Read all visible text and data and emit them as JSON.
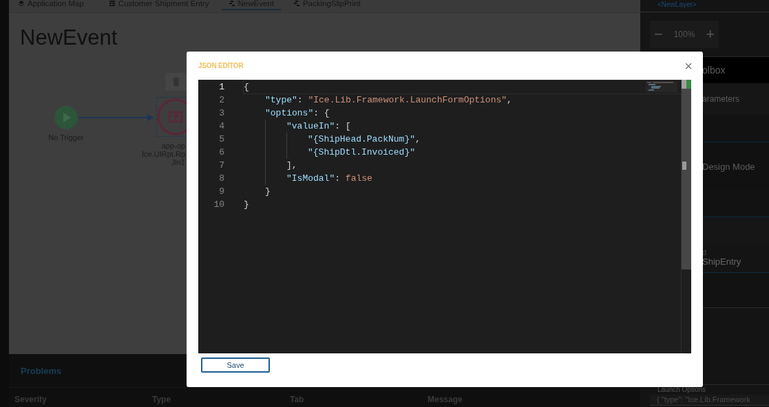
{
  "tabs": [
    {
      "label": "Application Map",
      "kind": "map",
      "selected": false
    },
    {
      "label": "Customer Shipment Entry",
      "kind": "form",
      "selected": false
    },
    {
      "label": "NewEvent",
      "kind": "event",
      "selected": true
    },
    {
      "label": "PackingSlipPrint",
      "kind": "event",
      "selected": false
    }
  ],
  "canvas": {
    "title": "NewEvent",
    "nodes": [
      {
        "kind": "trigger",
        "label_lines": [
          "No Trigger"
        ]
      },
      {
        "kind": "action",
        "label_lines": [
          "app-op",
          "Ice.UIRpt.Rp",
          "Jln1"
        ],
        "selected": true
      }
    ]
  },
  "problems": {
    "title": "Problems",
    "columns": [
      "Severity",
      "Type",
      "Tab",
      "Message"
    ]
  },
  "right_panel": {
    "layer": "<NewLayer>",
    "zoom": {
      "minus": "−",
      "value": "100%",
      "plus": "+"
    },
    "sections": [
      "olbox",
      "arameters",
      "Design Mode"
    ],
    "field_label": "d",
    "field_value": "ShipEntry",
    "options_label": "Launch Options",
    "options_value": "{ \"type\": \"Ice.Lib.Framework"
  },
  "dialog": {
    "title": "JSON EDITOR",
    "close": "×",
    "save": "Save",
    "code": [
      {
        "number": "1",
        "active": true,
        "tokens": [
          {
            "kind": "punct",
            "text": "{"
          }
        ],
        "children": [
          {
            "number": "2",
            "active": false,
            "tokens": [
              {
                "kind": "key",
                "text": "\"type\""
              },
              {
                "kind": "punct",
                "text": ": "
              },
              {
                "kind": "string",
                "text": "\"Ice.Lib.Framework.LaunchFormOptions\""
              },
              {
                "kind": "punct",
                "text": ","
              }
            ]
          },
          {
            "number": "3",
            "active": false,
            "tokens": [
              {
                "kind": "key",
                "text": "\"options\""
              },
              {
                "kind": "punct",
                "text": ": {"
              }
            ],
            "children": [
              {
                "number": "4",
                "active": false,
                "tokens": [
                  {
                    "kind": "key",
                    "text": "\"valueIn\""
                  },
                  {
                    "kind": "punct",
                    "text": ": ["
                  }
                ],
                "children": [
                  {
                    "number": "5",
                    "active": false,
                    "tokens": [
                      {
                        "kind": "string_key",
                        "text": "\"{ShipHead.PackNum}\""
                      },
                      {
                        "kind": "punct",
                        "text": ","
                      }
                    ]
                  },
                  {
                    "number": "6",
                    "active": false,
                    "tokens": [
                      {
                        "kind": "string_key",
                        "text": "\"{ShipDtl.Invoiced}\""
                      }
                    ]
                  }
                ]
              },
              {
                "number": "7",
                "active": false,
                "tokens": [
                  {
                    "kind": "punct",
                    "text": "],"
                  }
                ]
              },
              {
                "number": "8",
                "active": false,
                "tokens": [
                  {
                    "kind": "key",
                    "text": "\"IsModal\""
                  },
                  {
                    "kind": "punct",
                    "text": ": "
                  },
                  {
                    "kind": "keyword",
                    "text": "false"
                  }
                ]
              }
            ]
          },
          {
            "number": "9",
            "active": false,
            "tokens": [
              {
                "kind": "punct",
                "text": "}"
              }
            ]
          }
        ]
      },
      {
        "number": "10",
        "active": false,
        "tokens": [
          {
            "kind": "punct",
            "text": "}"
          }
        ]
      }
    ]
  }
}
